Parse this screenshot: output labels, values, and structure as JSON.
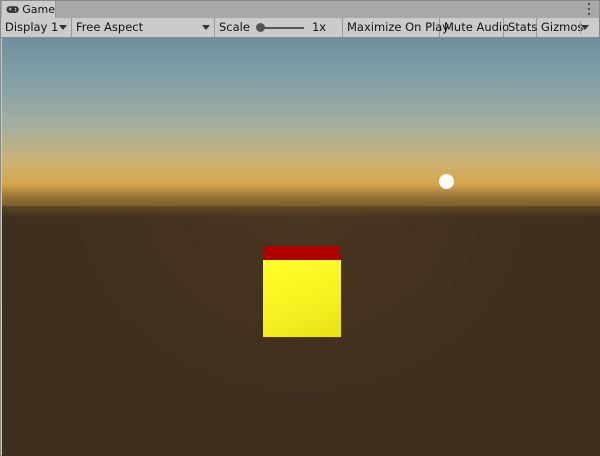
{
  "window": {
    "tab_label": "Game"
  },
  "toolbar": {
    "display": "Display 1",
    "aspect": "Free Aspect",
    "scale_label": "Scale",
    "scale_value": "1x",
    "maximize": "Maximize On Play",
    "mute": "Mute Audio",
    "stats": "Stats",
    "gizmos": "Gizmos"
  },
  "scene": {
    "sky_colors": [
      "#6f8e9d",
      "#a2aea0",
      "#d8a94e"
    ],
    "ground_color": "#3f2f1e",
    "sun_color": "#ffffff",
    "cube_front_color": "#ffff2a",
    "cube_top_color": "#b00000"
  },
  "icons": {
    "tab": "gamepad-icon",
    "menu": "kebab-menu-icon"
  }
}
